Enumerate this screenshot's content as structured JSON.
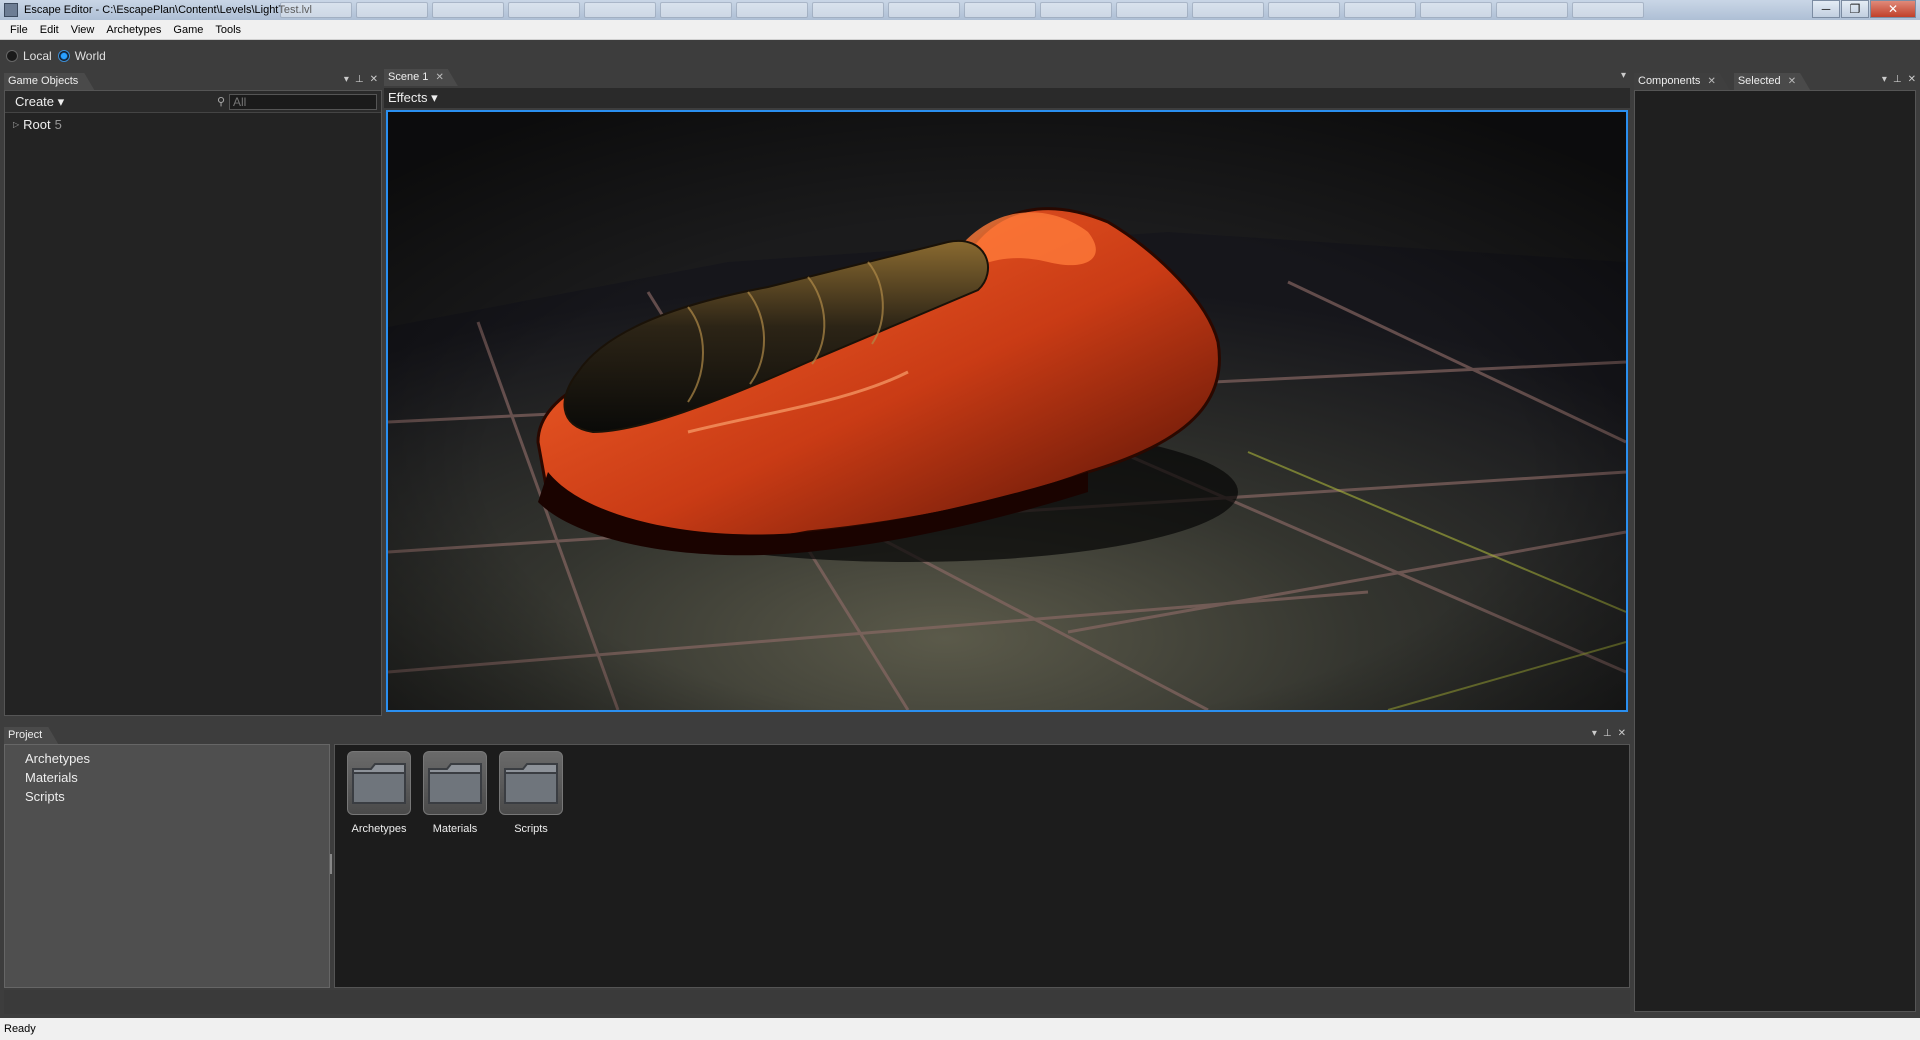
{
  "window": {
    "title": "Escape Editor - C:\\EscapePlan\\Content\\Levels\\LightTest.lvl",
    "minimize": "─",
    "maximize": "❐",
    "close": "✕"
  },
  "menu": [
    "File",
    "Edit",
    "View",
    "Archetypes",
    "Game",
    "Tools"
  ],
  "toolbar": {
    "local_label": "Local",
    "world_label": "World",
    "selected_space": "World"
  },
  "game_objects": {
    "tab_label": "Game Objects",
    "create_label": "Create ▾",
    "search_placeholder": "All",
    "root_label": "Root",
    "root_count": "5"
  },
  "scene": {
    "tab_label": "Scene 1",
    "effects_label": "Effects ▾"
  },
  "right_panel": {
    "tabs": [
      "Components",
      "Selected"
    ]
  },
  "project": {
    "tab_label": "Project",
    "tree": [
      "Archetypes",
      "Materials",
      "Scripts"
    ],
    "folders": [
      "Archetypes",
      "Materials",
      "Scripts"
    ]
  },
  "status": {
    "text": "Ready"
  },
  "colors": {
    "accent": "#2a8ff0",
    "model": "#d9481e",
    "background": "#3d3d3d"
  }
}
